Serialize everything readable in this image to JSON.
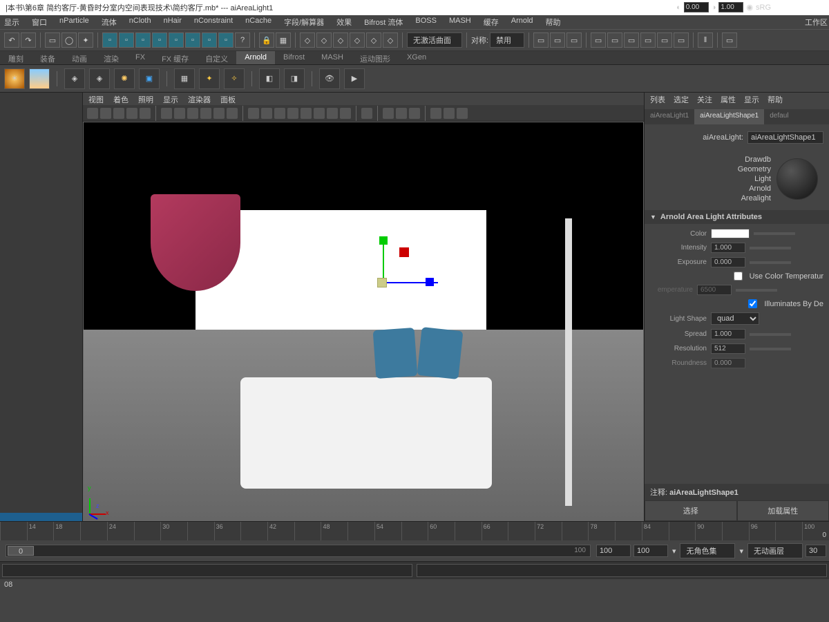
{
  "title": "|本书\\第6章 简约客厅-黄昏时分室内空间表现技术\\简约客厅.mb*  ---  aiAreaLight1",
  "workspace_label": "工作区",
  "menu": [
    "显示",
    "窗口",
    "nParticle",
    "流体",
    "nCloth",
    "nHair",
    "nConstraint",
    "nCache",
    "字段/解算器",
    "效果",
    "Bifrost 流体",
    "BOSS",
    "MASH",
    "缓存",
    "Arnold",
    "帮助"
  ],
  "toolbar": {
    "curve_dd": "无激活曲面",
    "sym_label": "对称:",
    "sym_dd": "禁用"
  },
  "shelftabs": [
    "雕刻",
    "装备",
    "动画",
    "渲染",
    "FX",
    "FX 缓存",
    "自定义",
    "Arnold",
    "Bifrost",
    "MASH",
    "运动图形",
    "XGen"
  ],
  "shelftab_active": "Arnold",
  "vp": {
    "menu": [
      "视图",
      "着色",
      "照明",
      "显示",
      "渲染器",
      "面板"
    ],
    "num_a": "0.00",
    "num_b": "1.00",
    "cs": "sRG"
  },
  "rpanel": {
    "menu": [
      "列表",
      "选定",
      "关注",
      "属性",
      "显示",
      "帮助"
    ],
    "tabs": [
      "aiAreaLight1",
      "aiAreaLightShape1",
      "defaul"
    ],
    "tab_active": "aiAreaLightShape1",
    "name_label": "aiAreaLight:",
    "name_value": "aiAreaLightShape1",
    "draw_labels": [
      "Drawdb",
      "Geometry",
      "Light",
      "Arnold",
      "Arealight"
    ],
    "section": "Arnold Area Light Attributes",
    "attrs": {
      "color": "Color",
      "intensity": "Intensity",
      "intensity_v": "1.000",
      "exposure": "Exposure",
      "exposure_v": "0.000",
      "usetemp": "Use Color Temperatur",
      "temperature": "emperature",
      "temperature_v": "6500",
      "illum": "Illuminates By De",
      "lightshape": "Light Shape",
      "lightshape_v": "quad",
      "spread": "Spread",
      "spread_v": "1.000",
      "resolution": "Resolution",
      "resolution_v": "512",
      "roundness": "Roundness",
      "roundness_v": "0.000"
    },
    "note_label": "注释:",
    "note_value": "aiAreaLightShape1",
    "btn_select": "选择",
    "btn_load": "加载属性"
  },
  "timeline": {
    "ticks": [
      "",
      "14",
      "18",
      "",
      "24",
      "",
      "30",
      "",
      "36",
      "",
      "42",
      "",
      "48",
      "",
      "54",
      "",
      "60",
      "",
      "66",
      "",
      "72",
      "",
      "78",
      "",
      "84",
      "",
      "90",
      "",
      "96",
      "",
      "100"
    ],
    "current": "0"
  },
  "range": {
    "start": "0",
    "end": "100",
    "f1": "100",
    "f2": "100",
    "charset": "无角色集",
    "animlayer": "无动画层",
    "last": "30"
  },
  "status": "08"
}
